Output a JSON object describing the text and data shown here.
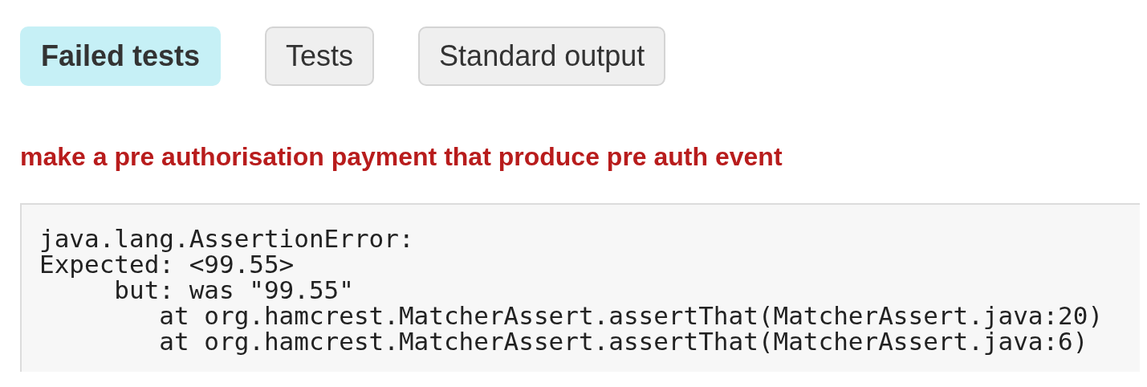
{
  "tabs": [
    {
      "label": "Failed tests",
      "selected": true
    },
    {
      "label": "Tests",
      "selected": false
    },
    {
      "label": "Standard output",
      "selected": false
    }
  ],
  "failed_test": {
    "name": "make a pre authorisation payment that produce pre auth event",
    "output": [
      "java.lang.AssertionError:",
      "Expected: <99.55>",
      "     but: was \"99.55\"",
      "        at org.hamcrest.MatcherAssert.assertThat(MatcherAssert.java:20)",
      "        at org.hamcrest.MatcherAssert.assertThat(MatcherAssert.java:6)"
    ]
  }
}
